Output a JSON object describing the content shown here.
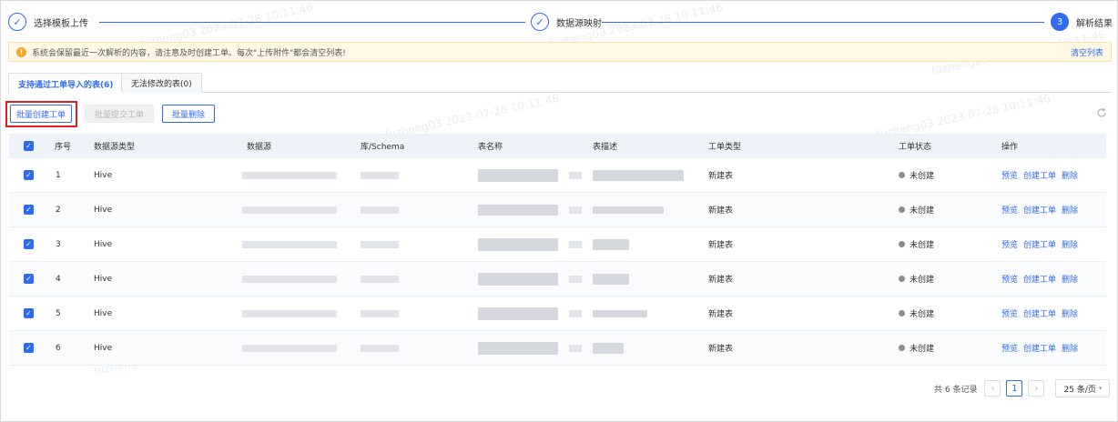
{
  "steps": [
    {
      "label": "选择模板上传",
      "marker": "✓"
    },
    {
      "label": "数据源映射",
      "marker": "✓"
    },
    {
      "label": "解析结果",
      "marker": "3"
    }
  ],
  "alert": {
    "text": "系统会保留最近一次解析的内容，请注意及时创建工单。每次\"上传附件\"都会清空列表!",
    "clear_link": "清空列表"
  },
  "tabs": [
    {
      "label": "支持通过工单导入的表(6)",
      "active": true
    },
    {
      "label": "无法修改的表(0)",
      "active": false
    }
  ],
  "toolbar": {
    "batch_create": "批量创建工单",
    "batch_submit": "批量提交工单",
    "batch_delete": "批量删除"
  },
  "table": {
    "headers": [
      "序号",
      "数据源类型",
      "数据源",
      "库/Schema",
      "表名称",
      "表描述",
      "工单类型",
      "工单状态",
      "操作"
    ],
    "rows": [
      {
        "index": "1",
        "source_type": "Hive",
        "ticket_type": "新建表",
        "status": "未创建"
      },
      {
        "index": "2",
        "source_type": "Hive",
        "ticket_type": "新建表",
        "status": "未创建"
      },
      {
        "index": "3",
        "source_type": "Hive",
        "ticket_type": "新建表",
        "status": "未创建"
      },
      {
        "index": "4",
        "source_type": "Hive",
        "ticket_type": "新建表",
        "status": "未创建"
      },
      {
        "index": "5",
        "source_type": "Hive",
        "ticket_type": "新建表",
        "status": "未创建"
      },
      {
        "index": "6",
        "source_type": "Hive",
        "ticket_type": "新建表",
        "status": "未创建"
      }
    ],
    "actions": [
      "预览",
      "创建工单",
      "删除"
    ]
  },
  "pagination": {
    "total": "共 6 条记录",
    "current_page": "1",
    "page_size": "25 条/页"
  },
  "watermark": "fuzheng03 2023-07-28 10:11:46",
  "colors": {
    "accent": "#2f6bf0",
    "warning": "#f5a623",
    "highlight": "#e0201e"
  }
}
